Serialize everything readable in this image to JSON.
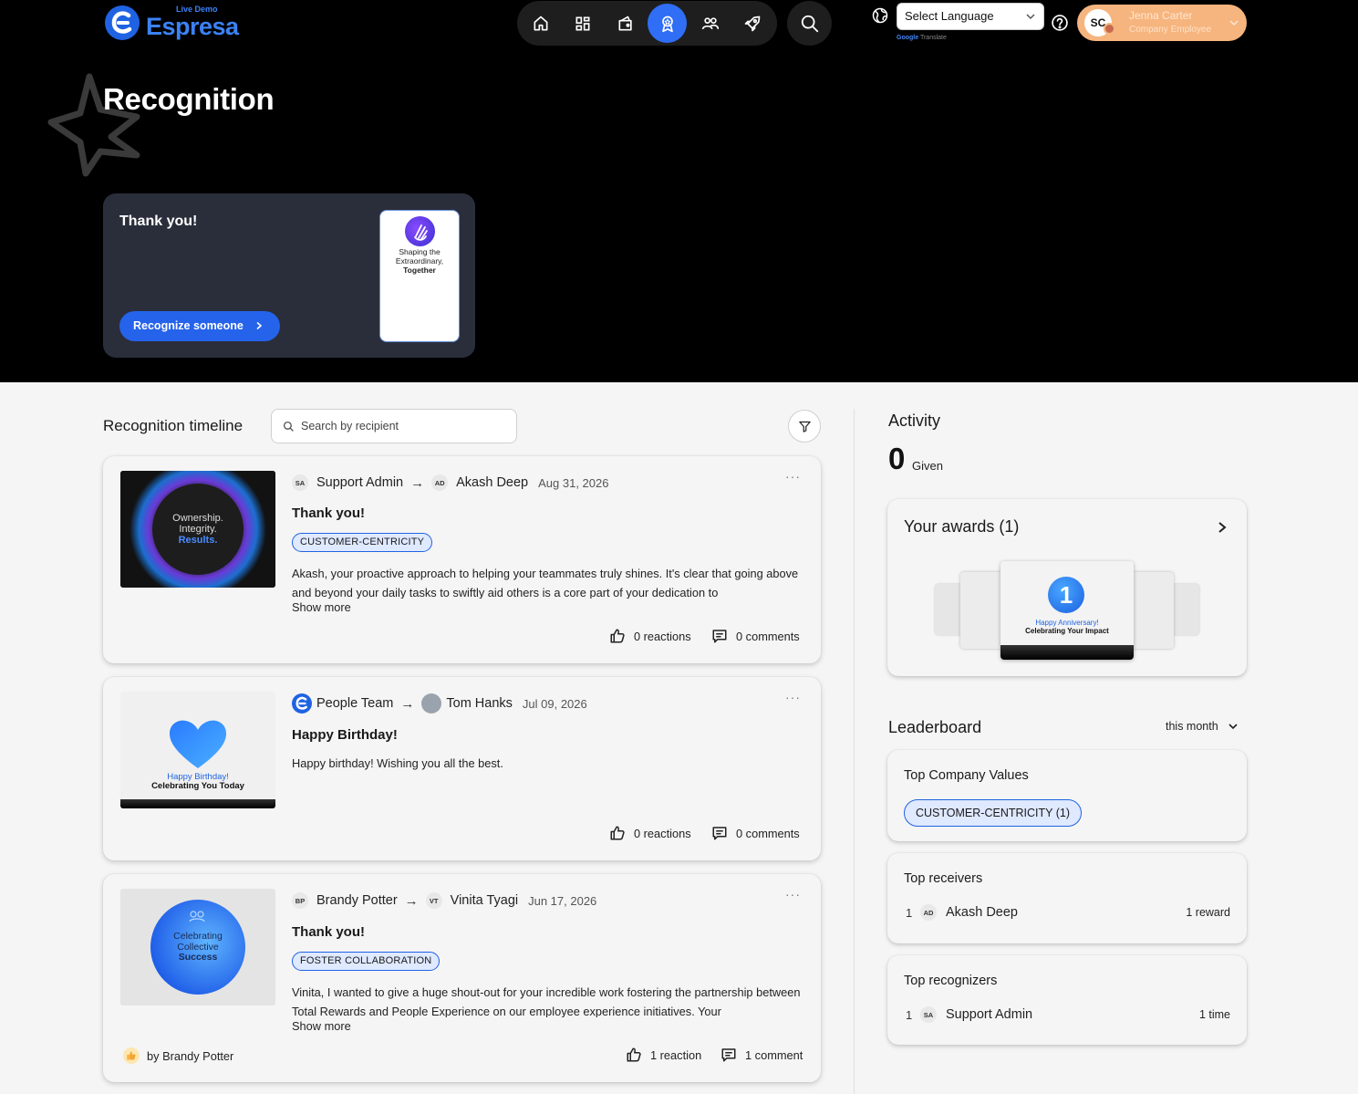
{
  "brand": {
    "name": "Espresa",
    "tag": "Live Demo"
  },
  "nav": {
    "items": [
      "home",
      "dashboard",
      "wallet",
      "recognition",
      "people",
      "rocket"
    ],
    "active": "recognition"
  },
  "language": {
    "label": "Select Language",
    "powered_by": "Google",
    "powered_suffix": "Translate"
  },
  "user": {
    "initials": "SC",
    "name": "Jenna Carter",
    "role": "Company Employee"
  },
  "page": {
    "title": "Recognition"
  },
  "hero_card": {
    "title": "Thank you!",
    "button": "Recognize someone",
    "mini_line1": "Shaping the",
    "mini_line2": "Extraordinary,",
    "mini_line3": "Together"
  },
  "timeline": {
    "title": "Recognition timeline",
    "search_placeholder": "Search by recipient",
    "posts": [
      {
        "from": "Support Admin",
        "from_initials": "SA",
        "to": "Akash Deep",
        "to_initials": "AD",
        "date": "Aug 31, 2026",
        "title": "Thank you!",
        "tag": "CUSTOMER-CENTRICITY",
        "body": "Akash, your proactive approach to helping your teammates truly shines. It's clear that going above and beyond your daily tasks to swiftly aid others is a core part of your dedication to",
        "show_more": "Show more",
        "reactions": "0 reactions",
        "comments": "0 comments",
        "img_line1": "Ownership.",
        "img_line2": "Integrity.",
        "img_line3": "Results."
      },
      {
        "from": "People Team",
        "to": "Tom Hanks",
        "date": "Jul 09, 2026",
        "title": "Happy Birthday!",
        "body": "Happy birthday! Wishing you all the best.",
        "reactions": "0 reactions",
        "comments": "0 comments",
        "img_line1": "Happy Birthday!",
        "img_line2": "Celebrating You Today"
      },
      {
        "from": "Brandy Potter",
        "from_initials": "BP",
        "to": "Vinita Tyagi",
        "to_initials": "VT",
        "date": "Jun 17, 2026",
        "title": "Thank you!",
        "tag": "FOSTER COLLABORATION",
        "body": "Vinita, I wanted to give a huge shout-out for your incredible work fostering the partnership between Total Rewards and People Experience on our employee experience initiatives. Your",
        "show_more": "Show more",
        "by": "by Brandy Potter",
        "reactions": "1 reaction",
        "comments": "1 comment",
        "img_line1": "Celebrating",
        "img_line2": "Collective",
        "img_line3": "Success"
      }
    ]
  },
  "activity": {
    "title": "Activity",
    "given_count": "0",
    "given_label": "Given",
    "awards_title": "Your awards (1)",
    "award_number": "1",
    "award_line1": "Happy Anniversary!",
    "award_line2": "Celebrating Your Impact"
  },
  "leaderboard": {
    "title": "Leaderboard",
    "period": "this month",
    "top_values_title": "Top Company Values",
    "top_value": "CUSTOMER-CENTRICITY (1)",
    "top_receivers_title": "Top receivers",
    "receiver": {
      "rank": "1",
      "initials": "AD",
      "name": "Akash Deep",
      "value": "1 reward"
    },
    "top_recognizers_title": "Top recognizers",
    "recognizer": {
      "rank": "1",
      "initials": "SA",
      "name": "Support Admin",
      "value": "1 time"
    }
  },
  "colors": {
    "accent": "#2563eb",
    "hero_bg": "#000000",
    "profile_bg": "#f6b57e",
    "tag_bg": "#dfe9ff"
  }
}
